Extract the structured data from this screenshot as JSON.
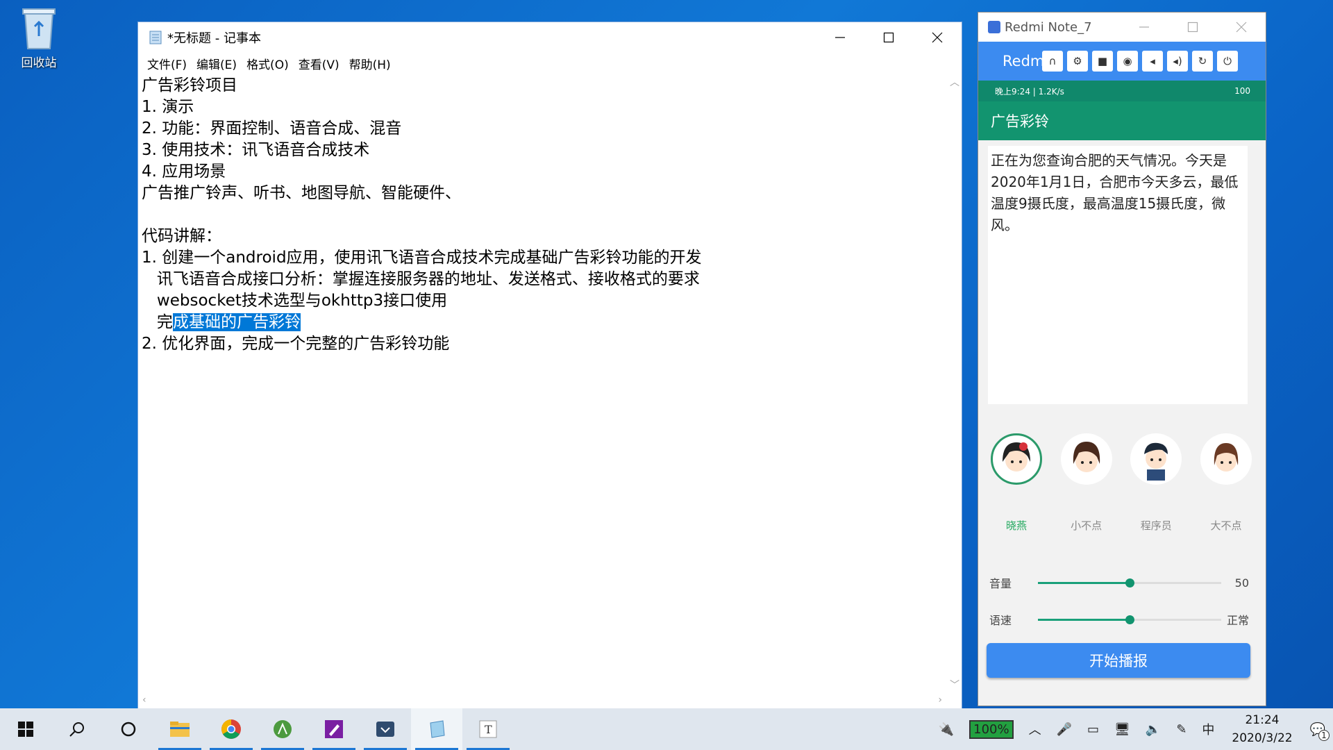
{
  "desktop": {
    "recycle_bin_label": "回收站"
  },
  "notepad": {
    "title": "*无标题 - 记事本",
    "menu": [
      "文件(F)",
      "编辑(E)",
      "格式(O)",
      "查看(V)",
      "帮助(H)"
    ],
    "lines": {
      "l1": "广告彩铃项目",
      "l2": "1. 演示",
      "l3": "2. 功能：界面控制、语音合成、混音",
      "l4": "3. 使用技术：讯飞语音合成技术",
      "l5": "4. 应用场景",
      "l6": "广告推广铃声、听书、地图导航、智能硬件、",
      "l7": "",
      "l8": "代码讲解：",
      "l9": "1. 创建一个android应用，使用讯飞语音合成技术完成基础广告彩铃功能的开发",
      "l10": "   讯飞语音合成接口分析：掌握连接服务器的地址、发送格式、接收格式的要求",
      "l11": "   websocket技术选型与okhttp3接口使用",
      "l12_pre": "   完",
      "l12_sel": "成基础的广告彩铃",
      "l13": "2. 优化界面，完成一个完整的广告彩铃功能"
    }
  },
  "phone": {
    "window_title": "Redmi Note_7",
    "toolbar_brand": "Redm",
    "status_left": "晚上9:24 | 1.2K/s",
    "status_right": "100",
    "app_title": "广告彩铃",
    "text": "正在为您查询合肥的天气情况。今天是2020年1月1日，合肥市今天多云，最低温度9摄氏度，最高温度15摄氏度，微风。",
    "speakers": [
      "晓燕",
      "小不点",
      "程序员",
      "大不点"
    ],
    "selected_speaker": "晓燕",
    "volume_label": "音量",
    "volume_value": "50",
    "volume_fraction": 0.5,
    "speed_label": "语速",
    "speed_value": "正常",
    "speed_fraction": 0.5,
    "play_button": "开始播报",
    "accent_color": "#12946f",
    "button_color": "#3c8bf0"
  },
  "taskbar": {
    "battery": "100%",
    "ime": "中",
    "time": "21:24",
    "date": "2020/3/22",
    "notifications": "1"
  }
}
